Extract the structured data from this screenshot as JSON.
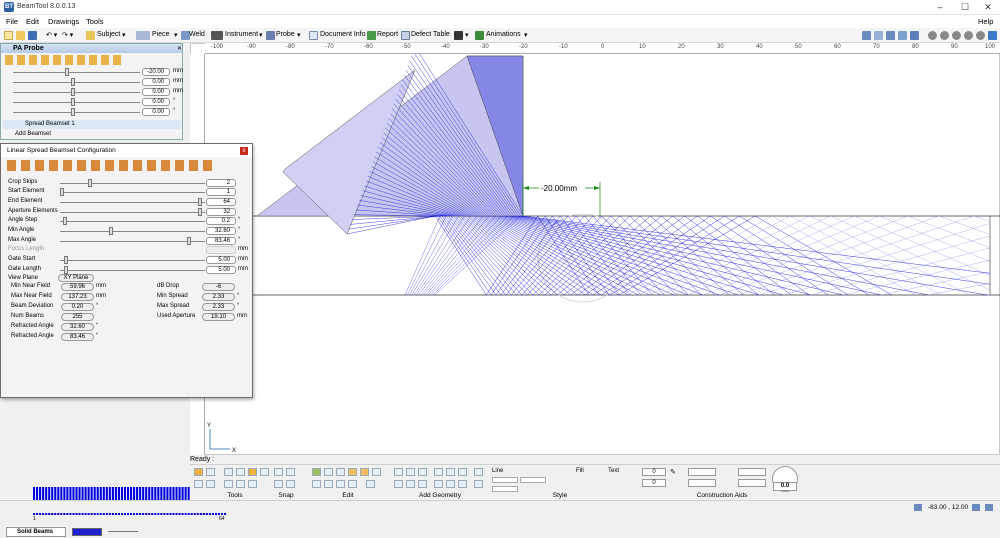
{
  "window": {
    "title": "BeamTool 8.0.0.13",
    "icon": "BT"
  },
  "menu": {
    "items": [
      "File",
      "Edit",
      "Drawings",
      "Tools"
    ],
    "help": "Help"
  },
  "toolbar": {
    "subject": "Subject",
    "piece": "Piece",
    "weld": "Weld",
    "instrument": "Instrument",
    "probe": "Probe",
    "document_info": "Document Info",
    "report": "Report",
    "defect_table": "Defect Table",
    "animations": "Animations"
  },
  "ruler": {
    "labels": [
      "-100",
      "-90",
      "-80",
      "-70",
      "-60",
      "-50",
      "-40",
      "-30",
      "-20",
      "-10",
      "0",
      "10",
      "20",
      "30",
      "40",
      "50",
      "60",
      "70",
      "80",
      "90",
      "100"
    ]
  },
  "drawing": {
    "dimension": "-20.00mm",
    "axis_y": "Y",
    "axis_x": "X",
    "beam_color": "#0000dd",
    "probe_color": "#c8c8f0"
  },
  "pa_probe": {
    "title": "PA Probe",
    "values": [
      "-20.00",
      "0.00",
      "0.00",
      "0.00",
      "0.00"
    ],
    "units": [
      "mm",
      "mm",
      "mm",
      "°",
      "°"
    ],
    "beamset": "Spread Beamset 1",
    "add_beamset": "Add Beamset"
  },
  "dialog": {
    "title": "Linear Spread Beamset Configuration",
    "rows": [
      {
        "label": "Crop Skips",
        "value": "2",
        "unit": "",
        "pos": 0.2
      },
      {
        "label": "Start Element",
        "value": "1",
        "unit": "",
        "pos": 0.0
      },
      {
        "label": "End Element",
        "value": "64",
        "unit": "",
        "pos": 0.98
      },
      {
        "label": "Aperture Elements",
        "value": "32",
        "unit": "",
        "pos": 0.98
      },
      {
        "label": "Angle Step",
        "value": "0.2",
        "unit": "°",
        "pos": 0.02
      },
      {
        "label": "Min Angle",
        "value": "32.60",
        "unit": "°",
        "pos": 0.35
      },
      {
        "label": "Max Angle",
        "value": "83.46",
        "unit": "°",
        "pos": 0.9
      },
      {
        "label": "Focus Length",
        "value": "",
        "unit": "mm",
        "pos": null
      },
      {
        "label": "Gate Start",
        "value": "5.00",
        "unit": "mm",
        "pos": 0.03
      },
      {
        "label": "Gate Length",
        "value": "5.00",
        "unit": "mm",
        "pos": 0.03
      }
    ],
    "view_plane_label": "View Plane",
    "view_plane": "XY Plane",
    "results_left": [
      {
        "label": "Min Near Field",
        "value": "59.96",
        "unit": "mm"
      },
      {
        "label": "Max Near Field",
        "value": "137.23",
        "unit": "mm"
      },
      {
        "label": "Beam Deviation",
        "value": "0.20",
        "unit": "°"
      },
      {
        "label": "Num Beams",
        "value": "255",
        "unit": ""
      },
      {
        "label": "Refracted Angle",
        "value": "32.60",
        "unit": "°"
      },
      {
        "label": "Refracted Angle",
        "value": "83.46",
        "unit": "°"
      }
    ],
    "results_right": [
      {
        "label": "dB Drop",
        "value": "-6",
        "unit": ""
      },
      {
        "label": "Min Spread",
        "value": "2.33",
        "unit": "°"
      },
      {
        "label": "Max Spread",
        "value": "2.33",
        "unit": "°"
      },
      {
        "label": "Used Aperture",
        "value": "19.10",
        "unit": "mm"
      }
    ],
    "elements_start": "1",
    "elements_end": "64",
    "solid_beams": "Solid Beams"
  },
  "bottom": {
    "ready": "Ready :",
    "groups": [
      "Tools",
      "Snap",
      "Edit",
      "Add Geometry",
      "Style",
      "Construction Aids"
    ],
    "line": "Line",
    "fill": "Fill",
    "text": "Text",
    "spin1": "0",
    "spin2": "0",
    "zoom": "0.0"
  },
  "status": {
    "coords": "-83.00 , 12.00"
  }
}
